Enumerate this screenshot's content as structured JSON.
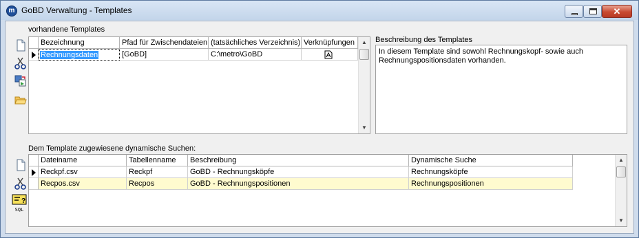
{
  "window": {
    "title": "GoBD Verwaltung - Templates",
    "app_icon_letter": "m"
  },
  "templates": {
    "section_label": "vorhandene Templates",
    "columns": [
      "Bezeichnung",
      "Pfad für Zwischendateien",
      "(tatsächliches Verzeichnis)",
      "Verknüpfungen"
    ],
    "rows": [
      {
        "bezeichnung": "Rechnungsdaten",
        "pfad": "[GoBD]",
        "verzeichnis": "C:\\metro\\GoBD",
        "verknuepfungen_icon": "document-link-icon"
      }
    ]
  },
  "description": {
    "label": "Beschreibung des Templates",
    "text": "In diesem Template sind sowohl Rechnungskopf- sowie auch Rechnungspositionsdaten vorhanden."
  },
  "searches": {
    "section_label": "Dem Template zugewiesene dynamische Suchen:",
    "columns": [
      "Dateiname",
      "Tabellenname",
      "Beschreibung",
      "Dynamische Suche"
    ],
    "rows": [
      {
        "dateiname": "Reckpf.csv",
        "tabellenname": "Reckpf",
        "beschreibung": "GoBD - Rechnungsköpfe",
        "suche": "Rechnungsköpfe"
      },
      {
        "dateiname": "Recpos.csv",
        "tabellenname": "Recpos",
        "beschreibung": "GoBD - Rechnungspositionen",
        "suche": "Rechnungspositionen"
      }
    ]
  },
  "toolbar_icons": {
    "new": "new-document-icon",
    "cut": "scissors-icon",
    "copy": "copy-template-icon",
    "open": "open-folder-icon",
    "sql": "sql-query-icon",
    "sql_label": "SQL"
  },
  "colors": {
    "selection": "#3399ff",
    "highlight_row": "#fffbcf",
    "title_bg": "#cfdcec"
  }
}
